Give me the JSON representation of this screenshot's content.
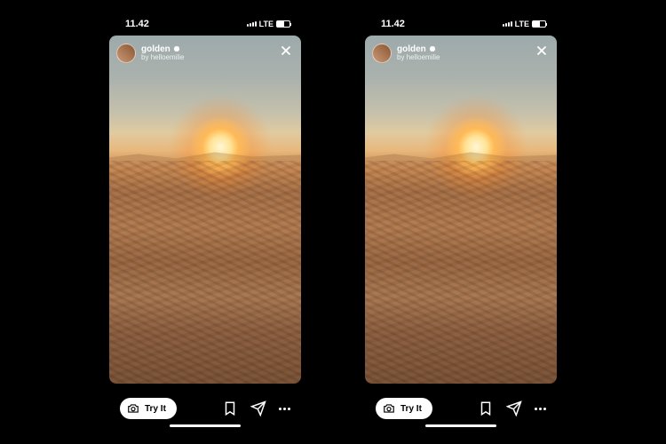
{
  "status": {
    "time": "11.42",
    "network": "LTE"
  },
  "filter": {
    "name": "golden",
    "author_prefix": "by",
    "author": "helloemilie"
  },
  "actions": {
    "try_label": "Try It"
  }
}
